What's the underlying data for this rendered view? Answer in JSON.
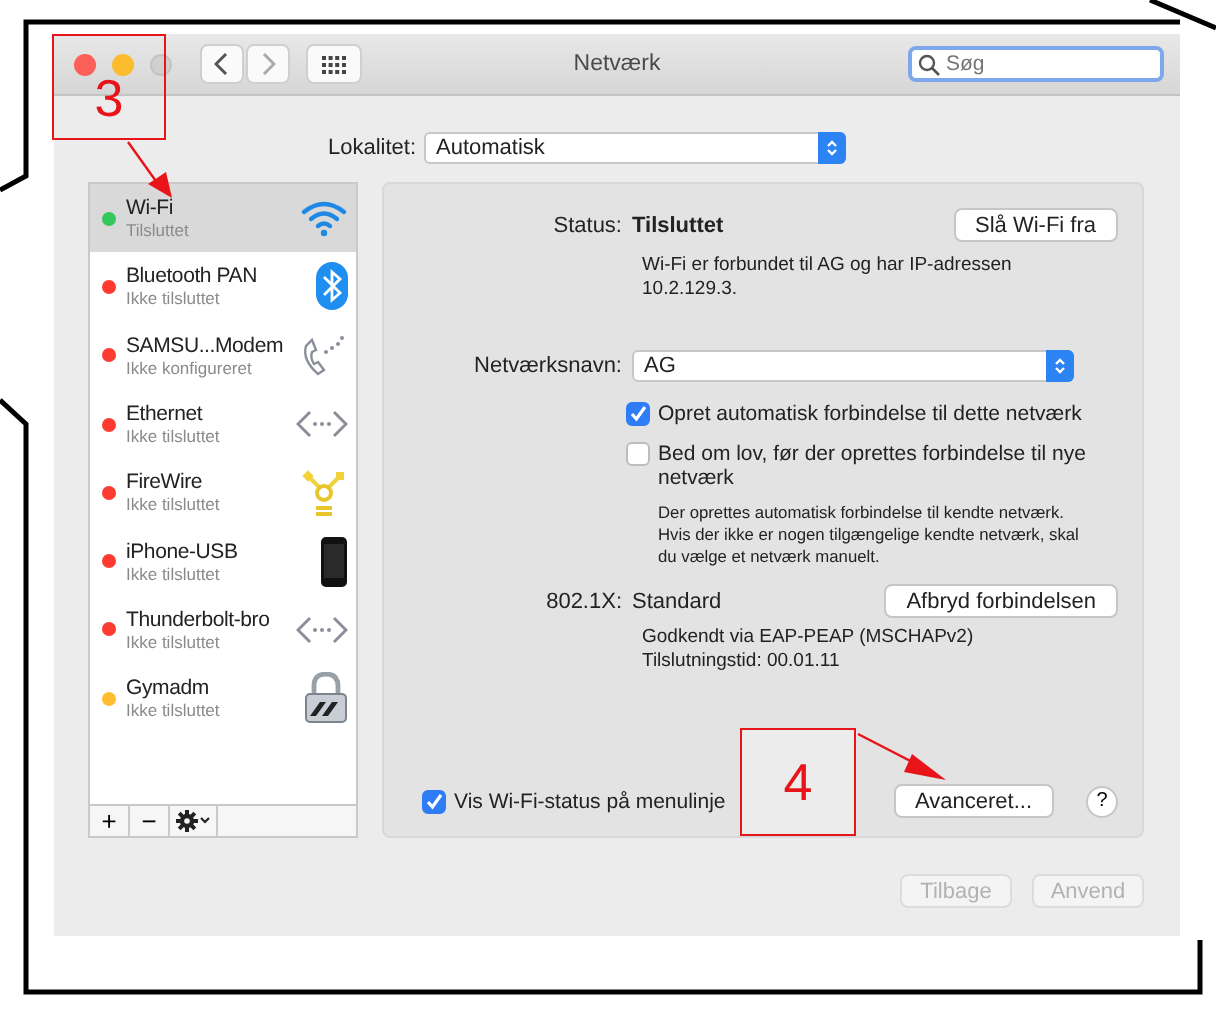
{
  "window": {
    "title": "Netværk"
  },
  "search": {
    "placeholder": "Søg"
  },
  "location": {
    "label": "Lokalitet:",
    "value": "Automatisk"
  },
  "services": [
    {
      "name": "Wi-Fi",
      "status": "Tilsluttet",
      "color": "#34c759",
      "selected": true,
      "kind": "wifi"
    },
    {
      "name": "Bluetooth PAN",
      "status": "Ikke tilsluttet",
      "color": "#fe3b30",
      "selected": false,
      "kind": "bluetooth"
    },
    {
      "name": "SAMSU...Modem",
      "status": "Ikke konfigureret",
      "color": "#fe3b30",
      "selected": false,
      "kind": "phone"
    },
    {
      "name": "Ethernet",
      "status": "Ikke tilsluttet",
      "color": "#fe3b30",
      "selected": false,
      "kind": "ethernet"
    },
    {
      "name": "FireWire",
      "status": "Ikke tilsluttet",
      "color": "#fe3b30",
      "selected": false,
      "kind": "firewire"
    },
    {
      "name": "iPhone-USB",
      "status": "Ikke tilsluttet",
      "color": "#fe3b30",
      "selected": false,
      "kind": "iphone"
    },
    {
      "name": "Thunderbolt-bro",
      "status": "Ikke tilsluttet",
      "color": "#fe3b30",
      "selected": false,
      "kind": "ethernet"
    },
    {
      "name": "Gymadm",
      "status": "Ikke tilsluttet",
      "color": "#febc2e",
      "selected": false,
      "kind": "lock"
    }
  ],
  "list_tools": [
    "+",
    "−"
  ],
  "detail": {
    "status_label": "Status:",
    "status_value": "Tilsluttet",
    "toggle_button": "Slå Wi-Fi fra",
    "status_note": "Wi-Fi er forbundet til AG og har IP-adressen 10.2.129.3.",
    "network_label": "Netværksnavn:",
    "network_value": "AG",
    "options": [
      {
        "label": "Opret automatisk forbindelse til dette netværk",
        "checked": true
      },
      {
        "label": "Bed om lov, før der oprettes forbindelse til nye netværk",
        "checked": false
      }
    ],
    "option_note": "Der oprettes automatisk forbindelse til kendte netværk. Hvis der ikke er nogen tilgængelige kendte netværk, skal du vælge et netværk manuelt.",
    "auth_label": "802.1X:",
    "auth_value": "Standard",
    "disconnect_button": "Afbryd forbindelsen",
    "auth_lines": [
      "Godkendt via EAP-PEAP (MSCHAPv2)",
      "Tilslutningstid: 00.01.11"
    ],
    "show_status": {
      "label": "Vis Wi-Fi-status på menulinje",
      "checked": true
    },
    "advanced_button": "Avanceret...",
    "help_button": "?"
  },
  "footer_buttons": [
    {
      "label": "Tilbage",
      "disabled": true
    },
    {
      "label": "Anvend",
      "disabled": true
    }
  ],
  "annotations": [
    {
      "label": "3"
    },
    {
      "label": "4"
    }
  ]
}
